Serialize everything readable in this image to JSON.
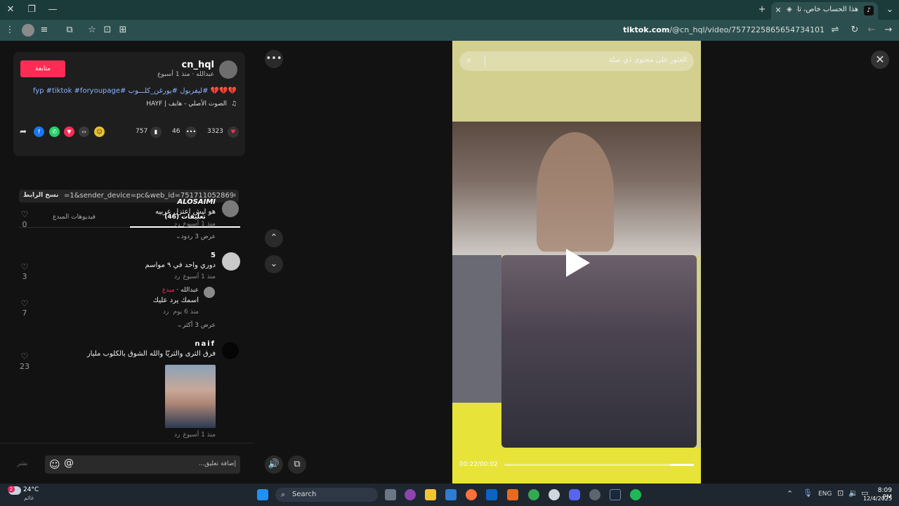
{
  "browser": {
    "tab_title": "هذا الحساب خاص، تابع هذا ا...",
    "favicon_text": "♪",
    "new_tab_label": "+",
    "url_domain": "tiktok.com",
    "url_path": "/@cn_hql/video/7577225865654734101"
  },
  "post": {
    "username": "cn_hql",
    "author_line": "عبدالله · منذ 1 أسبوع",
    "follow_label": "متابعة",
    "caption": "💔💔💔 #ليفربول #يورغن_كلـــوب #fyp #tiktok #foryoupage",
    "sound": "الصوت الأصلي - هايف | HAYF",
    "likes": "3323",
    "comments": "46",
    "saves": "757",
    "link_text": "=1&sender_device=pc&web_id=7517110528696026680...",
    "copy_link_label": "نسخ الرابط"
  },
  "tabs": {
    "comments_tab": "تعليقات (46)",
    "creator_videos_tab": "فيديوهات المبدع"
  },
  "comments": [
    {
      "user": "ALOSAIMI",
      "text": "هو ليش اعتزل عربيه",
      "time": "منذ 1 أسبوع",
      "reply": "رد",
      "likes": "0",
      "view_replies": "عرض 3 ردود"
    },
    {
      "user": "5",
      "text": "دوري واحد في ٩ مواسم",
      "time": "منذ 1 أسبوع",
      "reply": "رد",
      "likes": "3"
    },
    {
      "user": "عبدالله",
      "badge": "مبدع",
      "text": "اسمك يرد عليك",
      "time": "منذ 6 يوم",
      "reply": "رد",
      "likes": "7",
      "view_replies": "عرض 3 أكثر"
    },
    {
      "user": "naif",
      "text": "فرق الثرى والثريّا والله الشوق بالكلوب مليار",
      "time": "منذ 1 أسبوع",
      "reply": "رد",
      "likes": "23"
    }
  ],
  "composer": {
    "placeholder": "إضافة تعليق...",
    "post_label": "نشر"
  },
  "video": {
    "search_placeholder": "العثور على محتوى ذي صلة",
    "time_display": "00:22/00:02",
    "progress": 0.88
  },
  "taskbar": {
    "weather_temp": "24°C",
    "weather_label": "غائم",
    "weather_badge": "2",
    "search_label": "Search",
    "lang": "ENG",
    "time": "8:09 PM",
    "date": "12/4/2025"
  }
}
